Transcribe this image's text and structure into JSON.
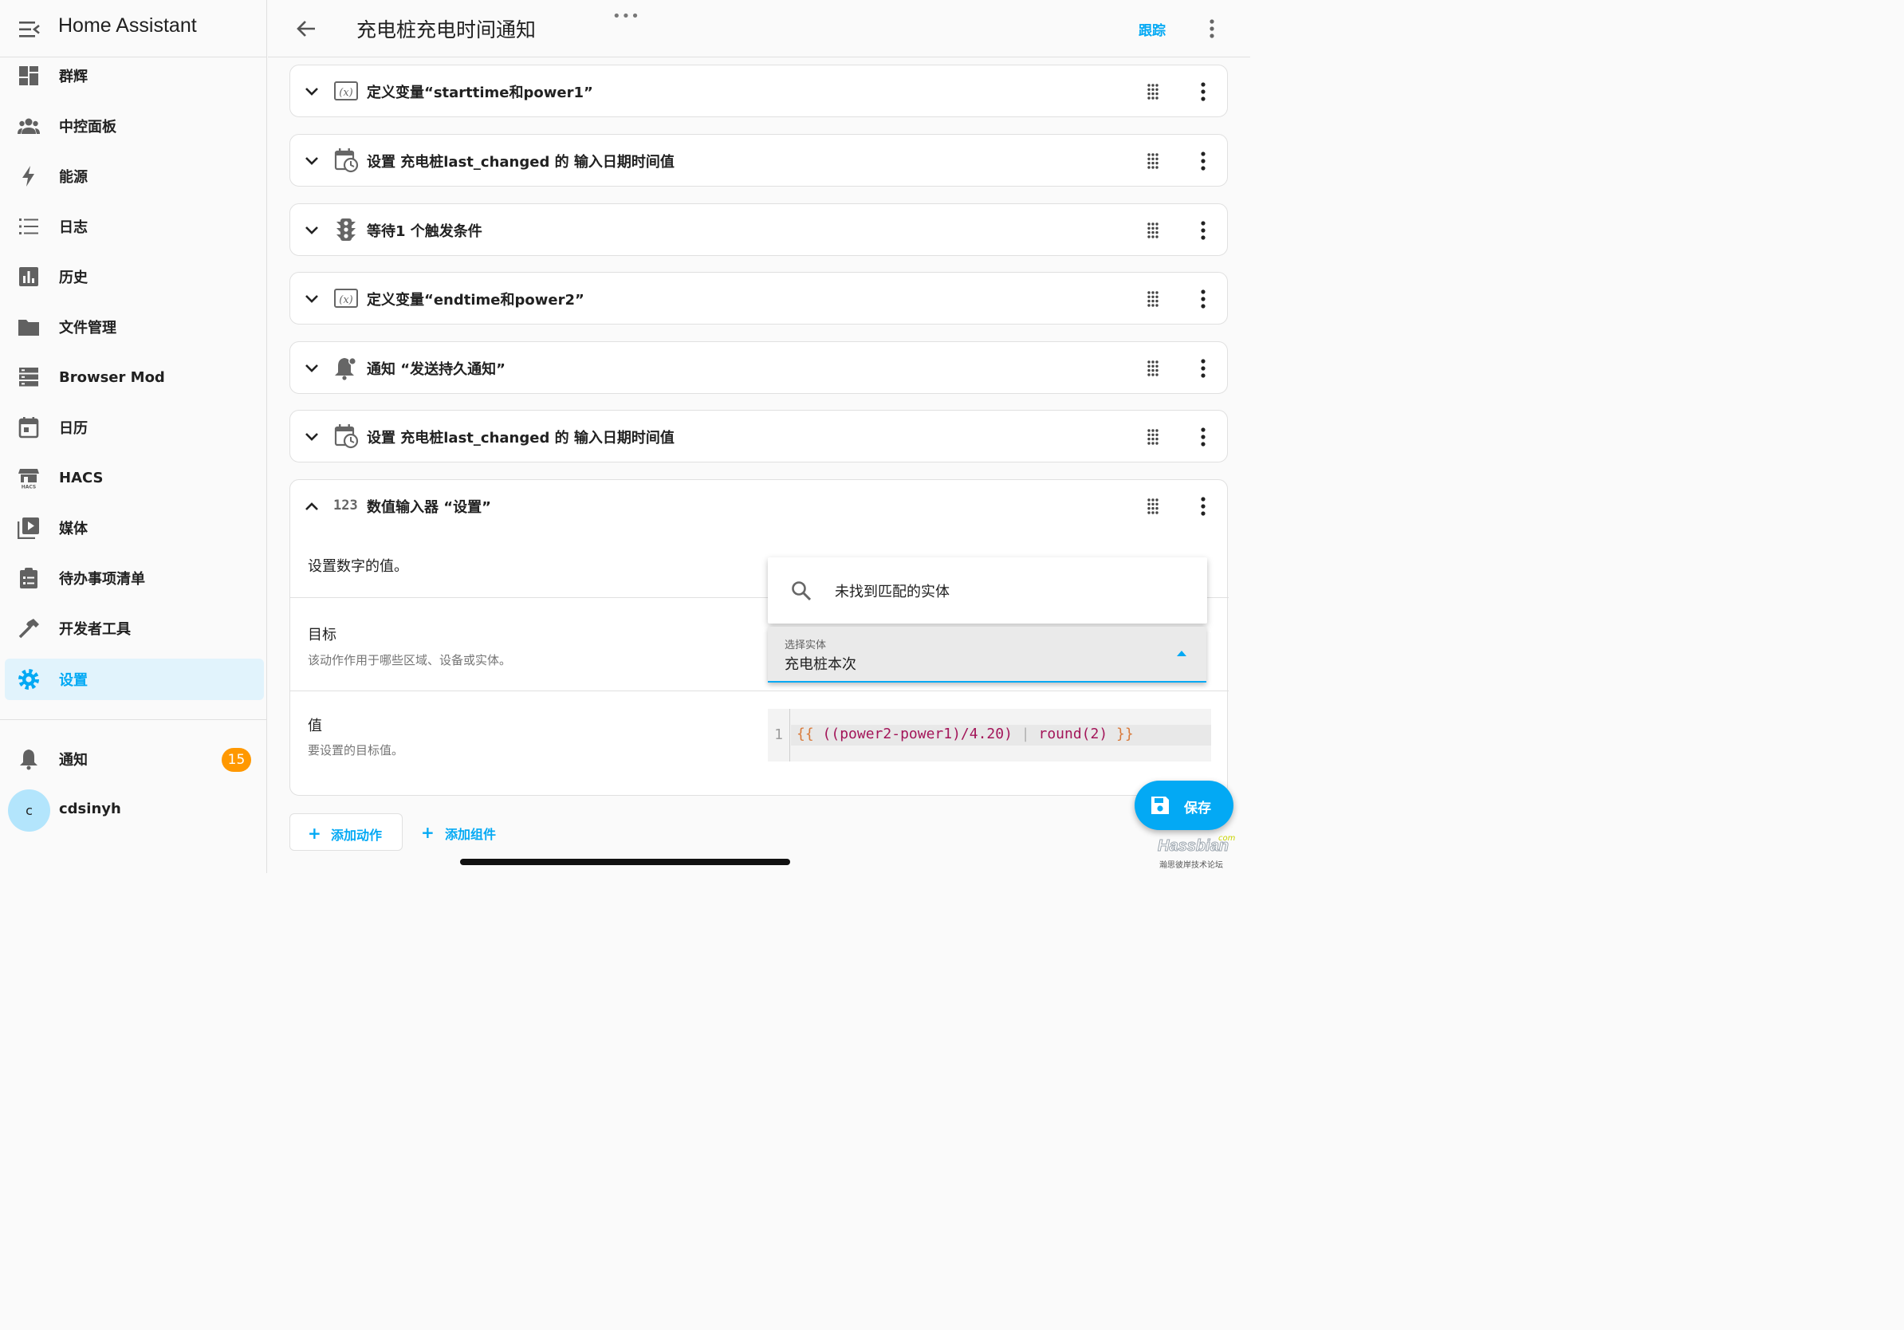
{
  "app": {
    "title": "Home Assistant"
  },
  "sidebar": {
    "items": [
      {
        "label": "群辉",
        "icon": "dashboard-icon"
      },
      {
        "label": "中控面板",
        "icon": "account-group-icon"
      },
      {
        "label": "能源",
        "icon": "lightning-bolt-icon"
      },
      {
        "label": "日志",
        "icon": "format-list-bulleted-icon"
      },
      {
        "label": "历史",
        "icon": "chart-box-icon"
      },
      {
        "label": "文件管理",
        "icon": "folder-icon"
      },
      {
        "label": "Browser Mod",
        "icon": "server-icon"
      },
      {
        "label": "日历",
        "icon": "calendar-icon"
      },
      {
        "label": "HACS",
        "icon": "hacs-icon"
      },
      {
        "label": "媒体",
        "icon": "play-box-multiple-icon"
      },
      {
        "label": "待办事项清单",
        "icon": "clipboard-list-icon"
      },
      {
        "label": "开发者工具",
        "icon": "hammer-icon"
      },
      {
        "label": "设置",
        "icon": "cog-icon",
        "active": true
      }
    ],
    "notifications": {
      "label": "通知",
      "count": "15"
    },
    "user": {
      "initial": "c",
      "name": "cdsinyh"
    }
  },
  "header": {
    "title": "充电桩充电时间通知",
    "dots": "•••",
    "trace_label": "跟踪"
  },
  "actions": [
    {
      "title": "定义变量“starttime和power1”",
      "icon": "variable-icon"
    },
    {
      "title": "设置 充电桩last_changed 的 输入日期时间值",
      "icon": "calendar-clock-icon"
    },
    {
      "title": "等待1 个触发条件",
      "icon": "traffic-light-icon"
    },
    {
      "title": "定义变量“endtime和power2”",
      "icon": "variable-icon"
    },
    {
      "title": "通知 “发送持久通知”",
      "icon": "bell-ring-icon"
    },
    {
      "title": "设置 充电桩last_changed 的 输入日期时间值",
      "icon": "calendar-clock-icon"
    }
  ],
  "expanded": {
    "icon_text": "123",
    "title": "数值输入器 “设置”",
    "description": "设置数字的值。",
    "target": {
      "label": "目标",
      "help": "该动作作用于哪些区域、设备或实体。"
    },
    "value": {
      "label": "值",
      "help": "要设置的目标值。"
    },
    "entity_picker": {
      "no_match": "未找到匹配的实体",
      "field_label": "选择实体",
      "field_value": "充电桩本次"
    },
    "code": {
      "line_number": "1",
      "open": "{{",
      "expr": "((power2-power1)/4.20)",
      "pipe": "|",
      "filter": "round(2)",
      "close": "}}"
    }
  },
  "buttons": {
    "add_action": "添加动作",
    "add_component": "添加组件",
    "save": "保存"
  },
  "watermark": {
    "brand": "Hassbian",
    "com": "com",
    "subtitle": "瀚思彼岸技术论坛"
  },
  "colors": {
    "accent": "#03a9f4",
    "badge": "#ff9800"
  }
}
